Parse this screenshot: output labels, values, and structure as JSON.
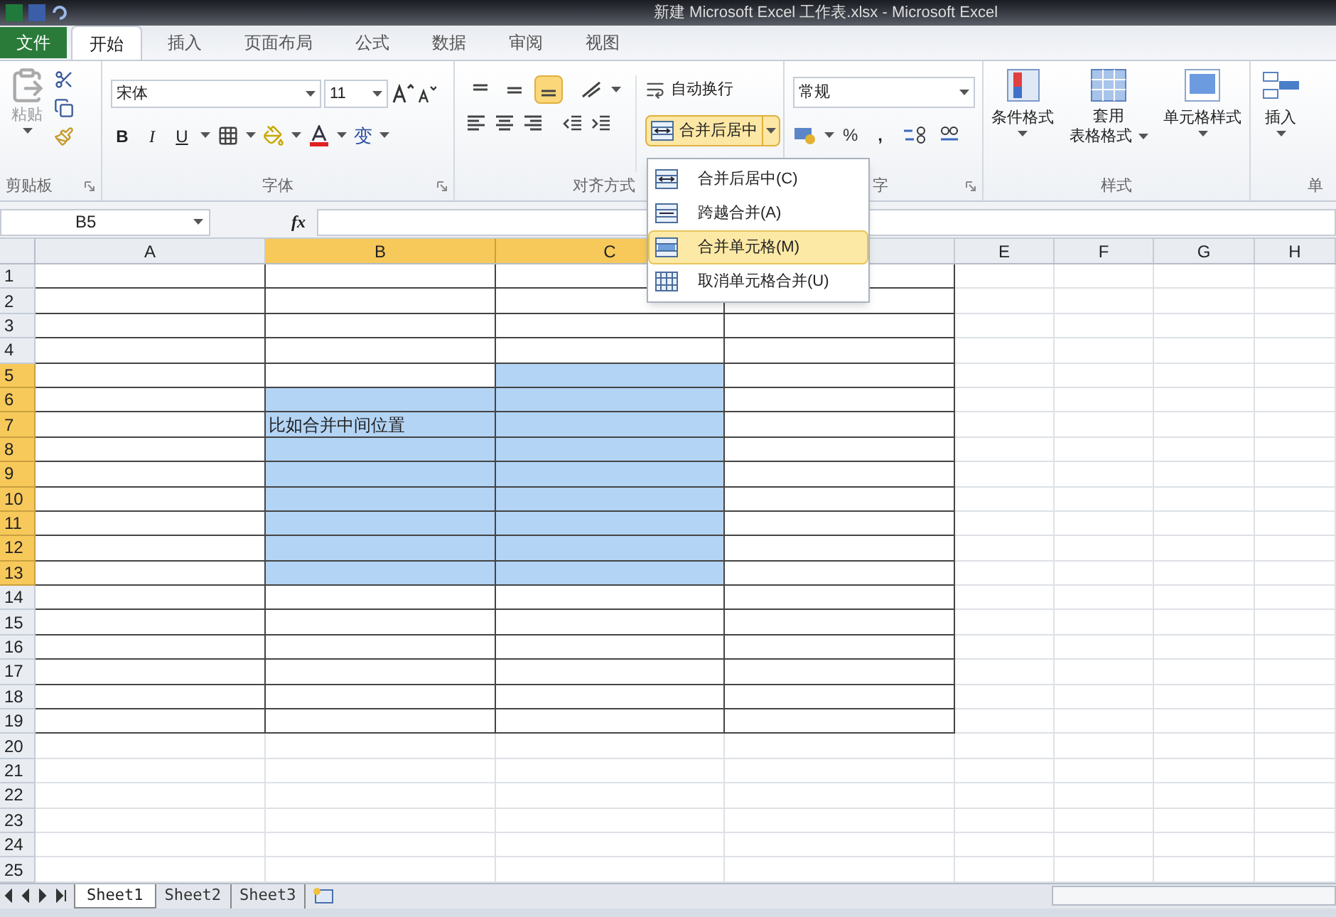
{
  "window": {
    "title": "新建 Microsoft Excel 工作表.xlsx - Microsoft Excel"
  },
  "file_tab": "文件",
  "tabs": [
    {
      "label": "开始",
      "selected": true
    },
    {
      "label": "插入",
      "selected": false
    },
    {
      "label": "页面布局",
      "selected": false
    },
    {
      "label": "公式",
      "selected": false
    },
    {
      "label": "数据",
      "selected": false
    },
    {
      "label": "审阅",
      "selected": false
    },
    {
      "label": "视图",
      "selected": false
    }
  ],
  "ribbon": {
    "clipboard": {
      "paste": "粘贴",
      "label": "剪贴板"
    },
    "font": {
      "font_name": "宋体",
      "font_size": "11",
      "bold": "B",
      "italic": "I",
      "underline": "U",
      "phonetic": "变",
      "label": "字体"
    },
    "alignment": {
      "bottom_align_on": true,
      "wrap_text": "自动换行",
      "merge_center": "合并后居中",
      "merge_open": true,
      "label": "对齐方式"
    },
    "number": {
      "format": "常规",
      "percent": "%",
      "comma": ",",
      "label_partial": "字"
    },
    "styles": {
      "conditional": "条件格式",
      "table_format": [
        "套用",
        "表格格式"
      ],
      "cell_styles": "单元格样式",
      "label": "样式"
    },
    "cells": {
      "insert": "插入",
      "label_partial": "单"
    }
  },
  "merge_menu": [
    {
      "label": "合并后居中(C)",
      "selected": false
    },
    {
      "label": "跨越合并(A)",
      "selected": false
    },
    {
      "label": "合并单元格(M)",
      "selected": true
    },
    {
      "label": "取消单元格合并(U)",
      "selected": false
    }
  ],
  "formula_bar": {
    "name_box": "B5",
    "fx": "fx"
  },
  "sheet": {
    "columns": [
      {
        "label": "A",
        "selected": false,
        "bordered": true
      },
      {
        "label": "B",
        "selected": true,
        "bordered": true
      },
      {
        "label": "C",
        "selected": true,
        "bordered": true
      },
      {
        "selected": false,
        "bordered": true
      },
      {
        "label": "E",
        "selected": false,
        "bordered": false
      },
      {
        "label": "F",
        "selected": false,
        "bordered": false
      },
      {
        "label": "G",
        "selected": false,
        "bordered": false
      },
      {
        "label": "H",
        "selected": false,
        "bordered": false
      }
    ],
    "rows": [
      {
        "label": "1",
        "selected": false,
        "bordered": true
      },
      {
        "label": "2",
        "selected": false,
        "bordered": true
      },
      {
        "label": "3",
        "selected": false,
        "bordered": true
      },
      {
        "label": "4",
        "selected": false,
        "bordered": true
      },
      {
        "label": "5",
        "selected": true,
        "bordered": true
      },
      {
        "label": "6",
        "selected": true,
        "bordered": true
      },
      {
        "label": "7",
        "selected": true,
        "bordered": true
      },
      {
        "label": "8",
        "selected": true,
        "bordered": true
      },
      {
        "label": "9",
        "selected": true,
        "bordered": true
      },
      {
        "label": "10",
        "selected": true,
        "bordered": true
      },
      {
        "label": "11",
        "selected": true,
        "bordered": true
      },
      {
        "label": "12",
        "selected": true,
        "bordered": true
      },
      {
        "label": "13",
        "selected": true,
        "bordered": true
      },
      {
        "label": "14",
        "selected": false,
        "bordered": true
      },
      {
        "label": "15",
        "selected": false,
        "bordered": true
      },
      {
        "label": "16",
        "selected": false,
        "bordered": true
      },
      {
        "label": "17",
        "selected": false,
        "bordered": true
      },
      {
        "label": "18",
        "selected": false,
        "bordered": true
      },
      {
        "label": "19",
        "selected": false,
        "bordered": true
      },
      {
        "label": "20",
        "selected": false,
        "bordered": false
      },
      {
        "label": "21",
        "selected": false,
        "bordered": false
      },
      {
        "label": "22",
        "selected": false,
        "bordered": false
      },
      {
        "label": "23",
        "selected": false,
        "bordered": false
      },
      {
        "label": "24",
        "selected": false,
        "bordered": false
      },
      {
        "label": "25",
        "selected": false,
        "bordered": false
      }
    ],
    "cell_b7": "比如合并中间位置"
  },
  "sheet_tabs": [
    {
      "label": "Sheet1",
      "selected": true
    },
    {
      "label": "Sheet2",
      "selected": false
    },
    {
      "label": "Sheet3",
      "selected": false
    }
  ]
}
